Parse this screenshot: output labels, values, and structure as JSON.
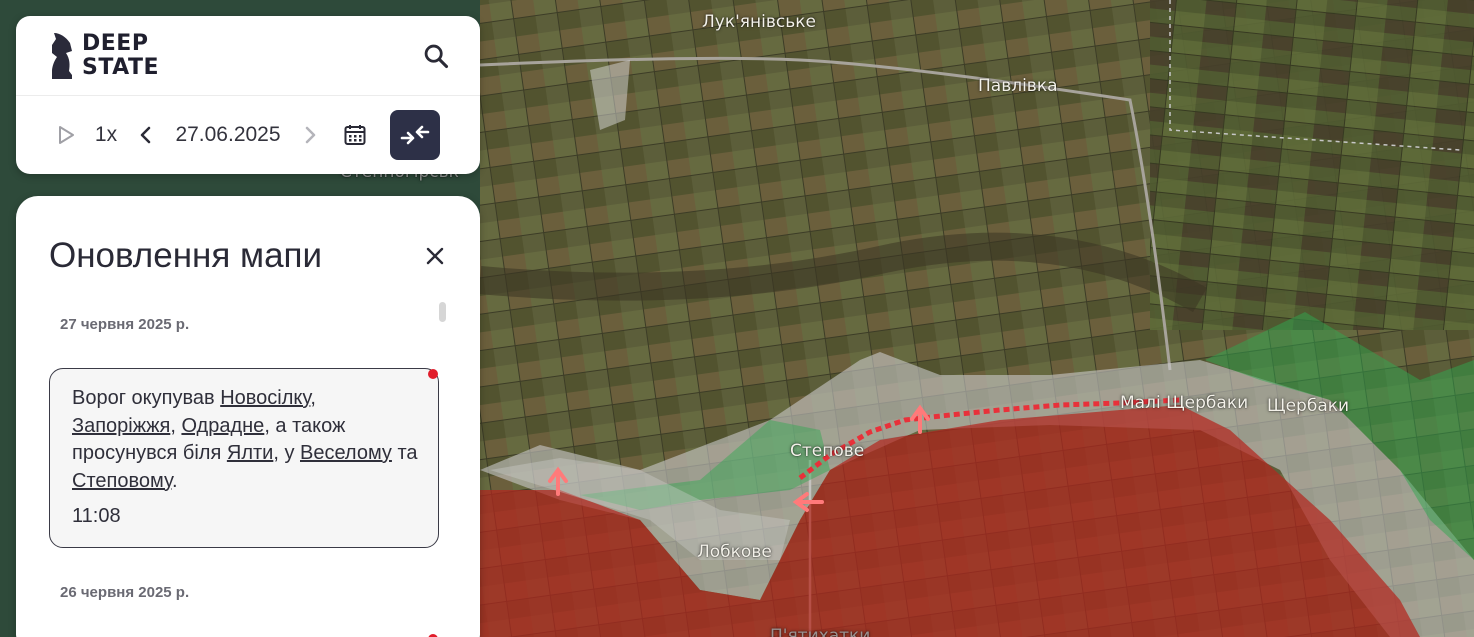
{
  "app": {
    "logo_line1": "DEEP",
    "logo_line2": "STATE"
  },
  "controls": {
    "speed": "1x",
    "date": "27.06.2025"
  },
  "panel": {
    "title": "Оновлення мапи",
    "groups": [
      {
        "date": "27 червня 2025 р.",
        "entry": {
          "t1": "Ворог окупував ",
          "l1": "Новосілку",
          "t2": ", ",
          "l2": "Запоріжжя",
          "t3": ", ",
          "l3": "Одрадне",
          "t4": ", а також просунувся біля ",
          "l4": "Ялти",
          "t5": ", у ",
          "l5": "Веселому",
          "t6": " та ",
          "l6": "Степовому",
          "t7": ".",
          "time": "11:08"
        }
      },
      {
        "date": "26 червня 2025 р."
      }
    ]
  },
  "map": {
    "places": {
      "lukianivske": "Лук'янівське",
      "pavlivka": "Павлівка",
      "stepnohirsk": "Степногірськ",
      "stepove": "Степове",
      "mali_shcherbaky": "Малі Щербаки",
      "shcherbaky": "Щербаки",
      "lobkove": "Лобкове",
      "piatykhatky": "П'ятихатки"
    },
    "colors": {
      "occupied": "#b3271e",
      "gray_zone": "#c9c9c9",
      "liberated": "#2fa84f",
      "advance": "#e8313a"
    }
  }
}
